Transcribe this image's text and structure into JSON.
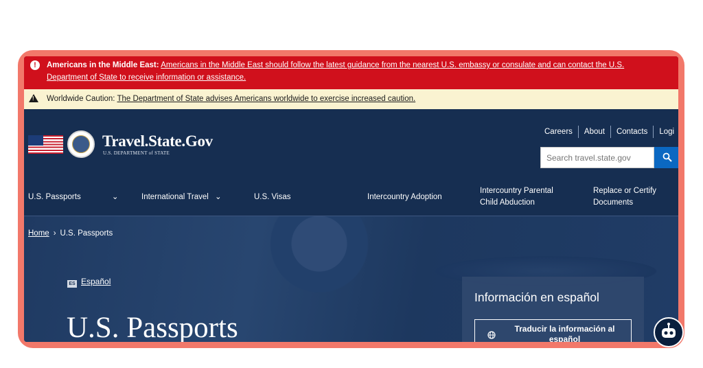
{
  "alerts": {
    "middle_east": {
      "label": "Americans in the Middle East:",
      "link": "Americans in the Middle East should follow the latest guidance from the nearest U.S. embassy or consulate and can contact the U.S. Department of State to receive information or assistance.",
      "color": "#d0101c",
      "icon": "exclamation-circle-icon"
    },
    "worldwide": {
      "label": "Worldwide Caution:",
      "link": "The Department of State advises Americans worldwide to exercise increased caution.",
      "color": "#faf3d1",
      "icon": "warning-triangle-icon"
    }
  },
  "header": {
    "site_title": "Travel.State.Gov",
    "site_subtitle": "U.S. DEPARTMENT of STATE",
    "top_links": [
      "Careers",
      "About",
      "Contacts",
      "Logi"
    ],
    "search_placeholder": "Search travel.state.gov",
    "search_button_color": "#0b68c2"
  },
  "nav": {
    "items": [
      {
        "label": "U.S. Passports",
        "has_dropdown": true
      },
      {
        "label": "International Travel",
        "has_dropdown": true
      },
      {
        "label": "U.S. Visas",
        "has_dropdown": false
      },
      {
        "label": "Intercountry Adoption",
        "has_dropdown": false
      },
      {
        "label": "Intercountry Parental Child Abduction",
        "has_dropdown": false
      },
      {
        "label": "Replace or Certify Documents",
        "has_dropdown": false
      }
    ]
  },
  "breadcrumb": {
    "home": "Home",
    "separator": "›",
    "current": "U.S. Passports"
  },
  "hero": {
    "language_badge": "ES",
    "language_link": "Español",
    "page_title": "U.S. Passports",
    "info_card": {
      "heading": "Información en español",
      "button_label": "Traducir la información al español"
    }
  },
  "colors": {
    "frame": "#f2786a",
    "header_bg": "#162e51"
  }
}
